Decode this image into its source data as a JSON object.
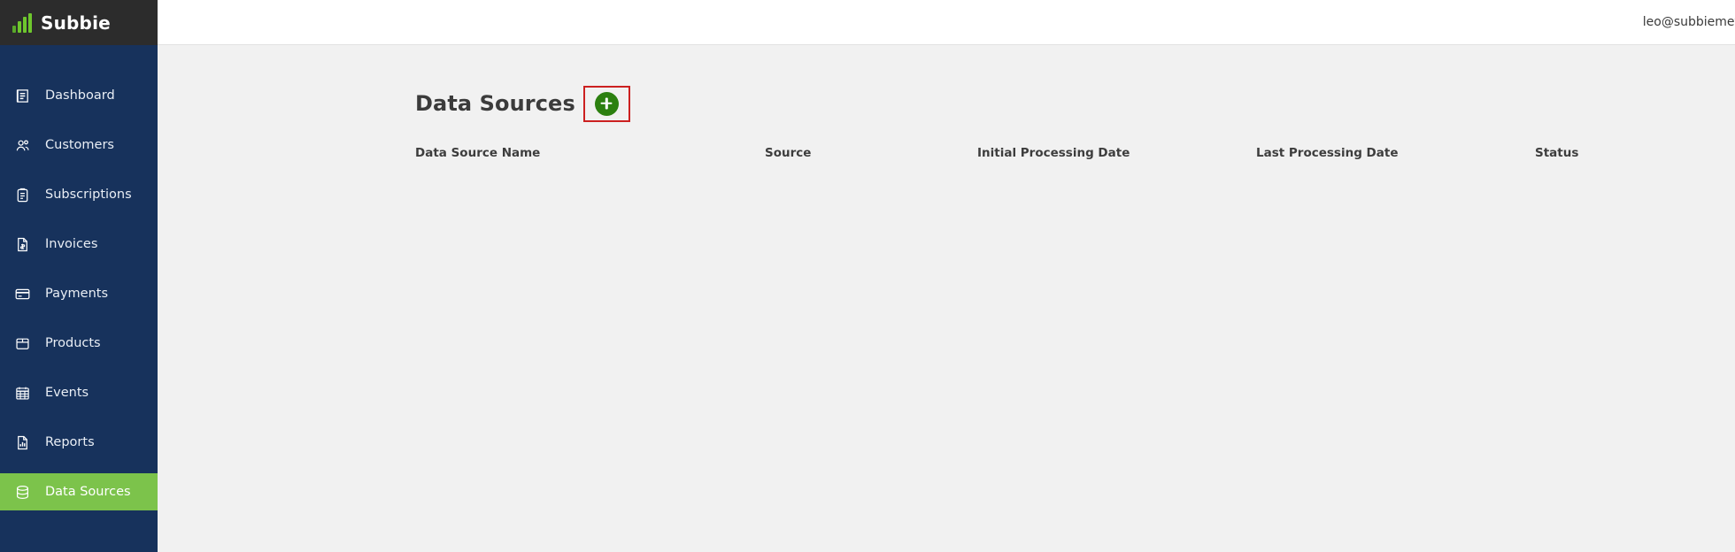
{
  "brand": {
    "name": "Subbie",
    "logo_icon": "bar-chart-icon"
  },
  "topbar": {
    "user_email": "leo@subbiemetrics.com",
    "caret_icon": "chevron-down-icon"
  },
  "sidebar": {
    "items": [
      {
        "label": "Dashboard",
        "icon": "dashboard-icon",
        "active": false
      },
      {
        "label": "Customers",
        "icon": "users-icon",
        "active": false
      },
      {
        "label": "Subscriptions",
        "icon": "clipboard-icon",
        "active": false
      },
      {
        "label": "Invoices",
        "icon": "invoice-icon",
        "active": false
      },
      {
        "label": "Payments",
        "icon": "credit-card-icon",
        "active": false
      },
      {
        "label": "Products",
        "icon": "box-icon",
        "active": false
      },
      {
        "label": "Events",
        "icon": "calendar-icon",
        "active": false
      },
      {
        "label": "Reports",
        "icon": "report-chart-icon",
        "active": false
      },
      {
        "label": "Data Sources",
        "icon": "database-icon",
        "active": true
      }
    ]
  },
  "page": {
    "title": "Data Sources",
    "add_button_icon": "plus-icon",
    "add_button_label": "+"
  },
  "table": {
    "columns": [
      "Data Source Name",
      "Source",
      "Initial Processing Date",
      "Last Processing Date",
      "Status"
    ],
    "rows": []
  },
  "colors": {
    "sidebar_bg": "#17325c",
    "sidebar_active": "#7cc34b",
    "brand_bg": "#2c2c2c",
    "brand_accent": "#6ec72d",
    "add_button": "#2c8010",
    "highlight_box": "#cc2020",
    "content_bg": "#f1f1f1",
    "topbar_bg": "#ffffff"
  }
}
